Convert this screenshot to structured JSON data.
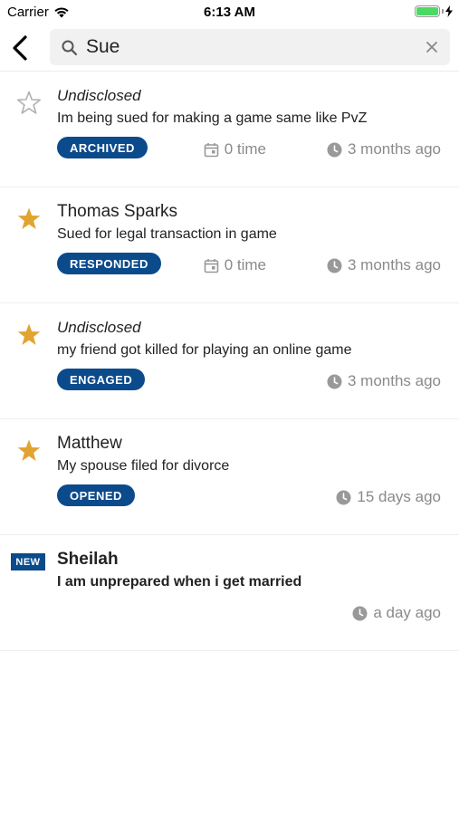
{
  "status_bar": {
    "carrier": "Carrier",
    "time": "6:13 AM",
    "battery_level": 1.0
  },
  "search": {
    "query": "Sue",
    "placeholder": ""
  },
  "colors": {
    "accent": "#0b4a8b",
    "star_filled": "#e2a431",
    "star_empty": "#b0b0b0",
    "meta_gray": "#8a8a8a"
  },
  "items": [
    {
      "name": "Undisclosed",
      "subject": "Im being sued for making a game same like PvZ",
      "status": "ARCHIVED",
      "count": "0 time",
      "time_ago": "3 months ago",
      "starred": false,
      "icon": "star-outline-icon"
    },
    {
      "name": "Thomas Sparks",
      "subject": "Sued for legal transaction in game",
      "status": "RESPONDED",
      "count": "0 time",
      "time_ago": "3 months ago",
      "starred": true,
      "icon": "star-filled-icon"
    },
    {
      "name": "Undisclosed",
      "subject": "my friend got killed for playing an online game",
      "status": "ENGAGED",
      "time_ago": "3 months ago",
      "starred": true,
      "icon": "star-filled-icon"
    },
    {
      "name": "Matthew",
      "subject": "My spouse filed for divorce",
      "status": "OPENED",
      "time_ago": "15 days ago",
      "starred": true,
      "icon": "star-filled-icon"
    },
    {
      "badge": "NEW",
      "name": "Sheilah",
      "subject": "I am unprepared when i get married",
      "time_ago": "a day ago"
    }
  ]
}
